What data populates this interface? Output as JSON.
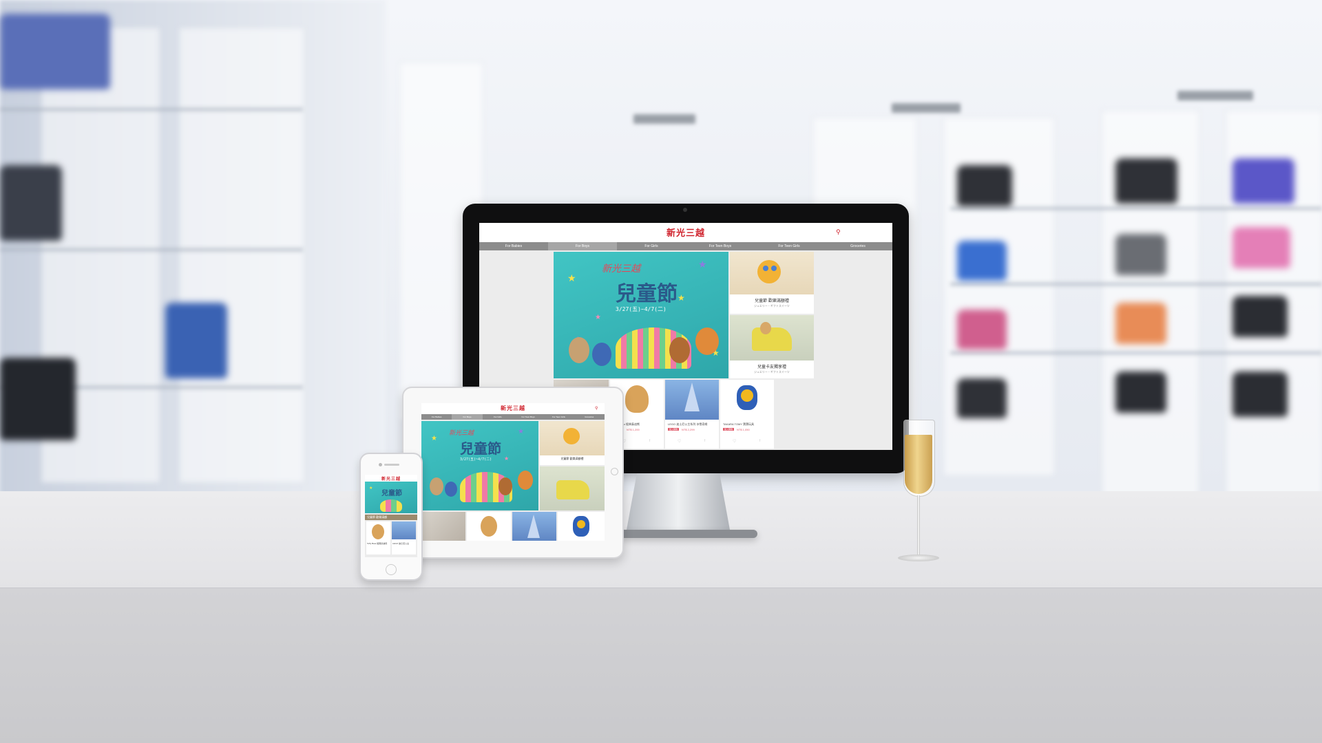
{
  "brand": {
    "logo": "新光三越",
    "accent": "#d0242e",
    "nav_bg": "#8c8c8c",
    "banner_teal": "#3bbcbd",
    "price_pink": "#e05a6a"
  },
  "desktop": {
    "nav": [
      "For Babies",
      "For Boys",
      "For Girls",
      "For Teen Boys",
      "For Teen Girls",
      "Groceries"
    ],
    "active_nav": 1,
    "banner": {
      "subtitle": "新光三越",
      "title": "兒童節",
      "dates": "3/27(五)~4/7(二)"
    },
    "side_tiles": [
      {
        "caption": "兒童節 歡樂滿額禮",
        "sub": "ジュエリー・ギフトスイーツ"
      },
      {
        "caption": "兒童卡友獨享禮",
        "sub": "ジュエリー・ギフトスイーツ"
      }
    ],
    "products": [
      {
        "name": "",
        "badge": "",
        "price": ""
      },
      {
        "name": "Toffy Bear 經典泰迪熊",
        "badge": "加入購物",
        "price": "NT$ 1,200"
      },
      {
        "name": "LEGO 迪士尼公主系列 冰雪奇緣",
        "badge": "加入購物",
        "price": "NT$ 2,299"
      },
      {
        "name": "TAKARA TOMY 寶寶玩具",
        "badge": "加入購物",
        "price": "NT$ 1,050"
      }
    ]
  },
  "tablet": {
    "nav": [
      "For Babies",
      "For Boys",
      "For Girls",
      "For Teen Boys",
      "For Teen Girls",
      "Groceries"
    ],
    "active_nav": 1,
    "tile_caption": "兒童節 歡樂滿額禮"
  },
  "phone": {
    "section_label": "兒童節 歡樂滿額",
    "products": [
      "Toffy Bear 經典泰迪熊",
      "LEGO 迪士尼公主"
    ]
  },
  "icons": [
    "search-icon",
    "heart-icon",
    "share-icon",
    "home-button-icon"
  ]
}
